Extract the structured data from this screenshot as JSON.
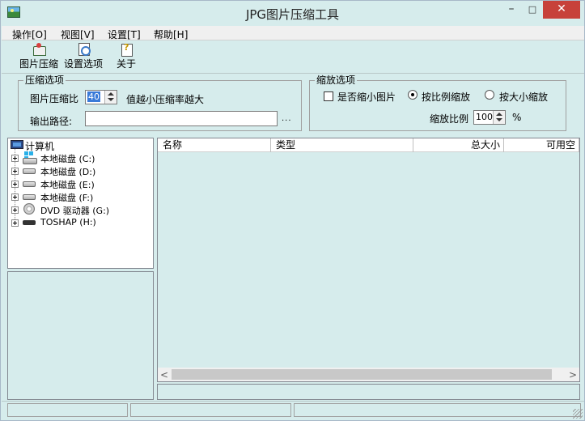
{
  "window": {
    "title": "JPG图片压缩工具",
    "minimize": "–",
    "maximize": "□",
    "close": "✕"
  },
  "menu": [
    "操作[O]",
    "视图[V]",
    "设置[T]",
    "帮助[H]"
  ],
  "toolbar": [
    {
      "label": "图片压缩",
      "icon": "compress-icon"
    },
    {
      "label": "设置选项",
      "icon": "settings-icon"
    },
    {
      "label": "关于",
      "icon": "about-icon"
    }
  ],
  "compress_group": {
    "title": "压缩选项",
    "ratio_label": "图片压缩比",
    "ratio_value": "40",
    "ratio_hint": "值越小压缩率越大",
    "output_label": "输出路径:",
    "output_value": "",
    "browse": "..."
  },
  "scale_group": {
    "title": "缩放选项",
    "shrink_label": "是否缩小图片",
    "shrink_checked": false,
    "by_ratio_label": "按比例缩放",
    "by_size_label": "按大小缩放",
    "scale_label": "缩放比例",
    "scale_value": "100",
    "percent": "%"
  },
  "tree": {
    "root": "计算机",
    "drives": [
      {
        "label": "本地磁盘 (C:)",
        "icon": "system-drive-icon"
      },
      {
        "label": "本地磁盘 (D:)",
        "icon": "drive-icon"
      },
      {
        "label": "本地磁盘 (E:)",
        "icon": "drive-icon"
      },
      {
        "label": "本地磁盘 (F:)",
        "icon": "drive-icon"
      },
      {
        "label": "DVD 驱动器 (G:)",
        "icon": "dvd-icon"
      },
      {
        "label": "TOSHAP (H:)",
        "icon": "usb-drive-icon"
      }
    ]
  },
  "list": {
    "columns": [
      "名称",
      "类型",
      "总大小",
      "可用空"
    ],
    "scroll_left": "<",
    "scroll_right": ">"
  }
}
